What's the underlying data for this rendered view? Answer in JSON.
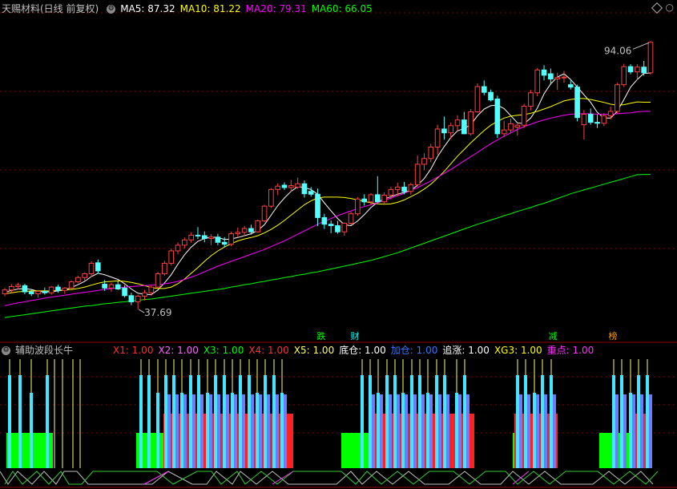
{
  "main_panel": {
    "title": "天赐材料(日线 前复权)",
    "indicators": [
      {
        "label": "MA5:",
        "value": "87.32",
        "color": "#ffffff"
      },
      {
        "label": "MA10:",
        "value": "81.22",
        "color": "#ffff00"
      },
      {
        "label": "MA20:",
        "value": "79.31",
        "color": "#ff00ff"
      },
      {
        "label": "MA60:",
        "value": "66.05",
        "color": "#00ff00"
      }
    ],
    "high_label": "94.06",
    "low_label": "37.69"
  },
  "signal_tags": [
    {
      "text": "跌",
      "color": "#00ff00"
    },
    {
      "text": "财",
      "color": "#00ffff"
    },
    {
      "text": "减",
      "color": "#00ff00"
    },
    {
      "text": "榜",
      "color": "#ff9900"
    }
  ],
  "sub_panel": {
    "title": "辅助波段长牛",
    "indicators": [
      {
        "label": "X1:",
        "value": "1.00",
        "color": "#ff3030"
      },
      {
        "label": "X2:",
        "value": "1.00",
        "color": "#ff66ff"
      },
      {
        "label": "X3:",
        "value": "1.00",
        "color": "#00ff00"
      },
      {
        "label": "X4:",
        "value": "1.00",
        "color": "#ff3030"
      },
      {
        "label": "X5:",
        "value": "1.00",
        "color": "#ffff66"
      },
      {
        "label": "底仓:",
        "value": "1.00",
        "color": "#ffffff"
      },
      {
        "label": "加仓:",
        "value": "1.00",
        "color": "#3377ff"
      },
      {
        "label": "追涨:",
        "value": "1.00",
        "color": "#ffffff"
      },
      {
        "label": "XG3:",
        "value": "1.00",
        "color": "#ffff00"
      },
      {
        "label": "重点:",
        "value": "1.00",
        "color": "#ff33ff"
      }
    ]
  },
  "chart_data": {
    "type": "candlestick",
    "title": "天赐材料(日线 前复权)",
    "ylim": [
      34,
      100
    ],
    "candles": [
      [
        41.0,
        42.2,
        40.5,
        41.8
      ],
      [
        41.8,
        43.0,
        41.2,
        42.5
      ],
      [
        42.5,
        43.3,
        41.9,
        42.8
      ],
      [
        42.7,
        43.1,
        40.9,
        41.4
      ],
      [
        41.4,
        42.0,
        40.5,
        41.0
      ],
      [
        41.0,
        41.8,
        40.2,
        41.5
      ],
      [
        41.5,
        42.3,
        40.8,
        41.2
      ],
      [
        41.2,
        42.6,
        40.8,
        42.4
      ],
      [
        42.4,
        42.9,
        41.2,
        41.7
      ],
      [
        41.7,
        42.4,
        41.0,
        42.2
      ],
      [
        42.2,
        43.8,
        42.0,
        43.5
      ],
      [
        43.5,
        44.8,
        43.2,
        44.4
      ],
      [
        44.4,
        45.5,
        43.8,
        45.2
      ],
      [
        45.2,
        47.8,
        44.5,
        47.4
      ],
      [
        47.5,
        48.2,
        45.2,
        45.8
      ],
      [
        43.0,
        43.9,
        41.6,
        42.2
      ],
      [
        42.2,
        43.3,
        41.4,
        42.9
      ],
      [
        42.9,
        43.6,
        41.8,
        42.0
      ],
      [
        42.2,
        42.8,
        40.2,
        40.6
      ],
      [
        40.6,
        41.2,
        38.6,
        39.3
      ],
      [
        39.3,
        40.8,
        37.7,
        40.5
      ],
      [
        40.5,
        41.8,
        39.6,
        41.2
      ],
      [
        41.2,
        42.8,
        40.6,
        42.4
      ],
      [
        42.4,
        45.6,
        42.1,
        45.2
      ],
      [
        45.2,
        47.9,
        44.8,
        47.4
      ],
      [
        47.4,
        50.5,
        46.9,
        50.0
      ],
      [
        50.0,
        51.8,
        49.3,
        51.2
      ],
      [
        51.2,
        52.8,
        50.5,
        52.3
      ],
      [
        52.3,
        53.9,
        51.7,
        53.3
      ],
      [
        53.3,
        55.0,
        52.5,
        53.2
      ],
      [
        53.2,
        54.1,
        51.8,
        52.6
      ],
      [
        52.6,
        53.5,
        51.2,
        52.9
      ],
      [
        52.9,
        53.6,
        51.2,
        51.8
      ],
      [
        51.8,
        52.9,
        50.8,
        51.4
      ],
      [
        51.4,
        54.0,
        51.0,
        53.6
      ],
      [
        53.6,
        54.9,
        52.8,
        53.9
      ],
      [
        53.9,
        55.2,
        53.1,
        54.7
      ],
      [
        54.7,
        55.5,
        53.4,
        54.0
      ],
      [
        54.0,
        56.6,
        53.8,
        56.3
      ],
      [
        56.3,
        59.7,
        56.0,
        59.4
      ],
      [
        59.4,
        63.2,
        59.0,
        62.9
      ],
      [
        62.9,
        64.2,
        61.7,
        63.6
      ],
      [
        63.8,
        64.4,
        62.8,
        63.3
      ],
      [
        63.3,
        64.9,
        62.4,
        63.7
      ],
      [
        63.4,
        65.4,
        63.0,
        64.1
      ],
      [
        64.1,
        64.8,
        61.2,
        62.0
      ],
      [
        62.5,
        63.4,
        61.4,
        61.9
      ],
      [
        61.9,
        63.1,
        55.2,
        57.0
      ],
      [
        57.0,
        57.8,
        54.6,
        55.6
      ],
      [
        55.6,
        56.4,
        53.7,
        55.3
      ],
      [
        55.3,
        56.3,
        53.6,
        54.0
      ],
      [
        54.0,
        56.0,
        53.2,
        55.8
      ],
      [
        55.8,
        58.2,
        55.4,
        57.8
      ],
      [
        57.8,
        61.3,
        57.4,
        60.9
      ],
      [
        60.9,
        61.9,
        59.5,
        60.3
      ],
      [
        60.3,
        62.1,
        59.6,
        61.8
      ],
      [
        61.8,
        65.7,
        61.3,
        60.3
      ],
      [
        60.3,
        62.3,
        59.7,
        61.7
      ],
      [
        61.7,
        63.5,
        60.8,
        62.9
      ],
      [
        62.9,
        64.3,
        61.5,
        63.4
      ],
      [
        63.4,
        64.5,
        61.9,
        62.5
      ],
      [
        62.5,
        64.3,
        61.8,
        63.9
      ],
      [
        63.9,
        70.0,
        63.5,
        68.2
      ],
      [
        68.2,
        70.5,
        67.0,
        69.4
      ],
      [
        69.4,
        72.5,
        68.6,
        71.8
      ],
      [
        71.8,
        76.5,
        70.2,
        75.6
      ],
      [
        75.6,
        78.2,
        73.4,
        74.8
      ],
      [
        74.8,
        76.9,
        73.6,
        76.3
      ],
      [
        76.3,
        78.5,
        75.2,
        77.5
      ],
      [
        77.5,
        79.2,
        74.5,
        74.6
      ],
      [
        74.6,
        79.8,
        74.2,
        79.2
      ],
      [
        79.2,
        85.2,
        79.0,
        84.5
      ],
      [
        84.5,
        85.8,
        82.7,
        83.3
      ],
      [
        83.3,
        83.9,
        81.4,
        81.7
      ],
      [
        81.9,
        82.6,
        73.7,
        74.6
      ],
      [
        74.6,
        77.3,
        74.0,
        75.4
      ],
      [
        75.4,
        77.8,
        74.7,
        76.7
      ],
      [
        76.0,
        76.9,
        74.2,
        76.4
      ],
      [
        76.4,
        80.9,
        75.8,
        80.4
      ],
      [
        80.4,
        83.8,
        79.5,
        83.2
      ],
      [
        83.2,
        88.4,
        82.5,
        88.0
      ],
      [
        88.0,
        89.0,
        85.8,
        86.9
      ],
      [
        87.2,
        88.3,
        84.9,
        86.1
      ],
      [
        86.1,
        87.4,
        83.8,
        86.4
      ],
      [
        86.4,
        87.8,
        85.3,
        86.5
      ],
      [
        84.9,
        85.8,
        83.9,
        84.4
      ],
      [
        84.4,
        84.9,
        77.2,
        78.0
      ],
      [
        76.5,
        79.6,
        73.4,
        78.7
      ],
      [
        78.7,
        79.9,
        76.5,
        77.0
      ],
      [
        77.0,
        78.6,
        75.8,
        76.8
      ],
      [
        76.8,
        78.9,
        76.2,
        78.4
      ],
      [
        78.4,
        80.3,
        77.6,
        79.3
      ],
      [
        79.3,
        85.3,
        78.9,
        84.9
      ],
      [
        84.9,
        89.3,
        84.4,
        88.7
      ],
      [
        88.7,
        89.2,
        87.1,
        87.6
      ],
      [
        87.6,
        89.2,
        85.9,
        88.6
      ],
      [
        88.6,
        89.9,
        86.8,
        87.4
      ],
      [
        87.4,
        94.06,
        87.0,
        93.8
      ]
    ],
    "lines": [
      {
        "name": "MA5",
        "color": "#ffffff",
        "values": [
          41.3,
          41.7,
          42.0,
          42.1,
          41.9,
          41.5,
          41.4,
          41.4,
          41.6,
          41.8,
          42.3,
          42.9,
          43.6,
          44.6,
          45.3,
          45.0,
          44.5,
          44.0,
          43.1,
          42.0,
          41.1,
          40.9,
          40.8,
          41.8,
          43.3,
          45.0,
          47.2,
          49.2,
          50.8,
          52.0,
          52.6,
          52.9,
          52.8,
          52.4,
          52.5,
          52.8,
          53.2,
          53.6,
          54.3,
          55.5,
          57.5,
          59.5,
          61.1,
          62.5,
          63.5,
          63.3,
          62.9,
          61.9,
          60.1,
          58.4,
          56.8,
          55.5,
          55.3,
          56.3,
          57.6,
          59.1,
          60.2,
          60.9,
          61.4,
          61.9,
          62.3,
          62.7,
          63.8,
          65.2,
          67.2,
          69.8,
          71.9,
          73.8,
          75.2,
          75.7,
          76.5,
          78.4,
          79.8,
          80.5,
          80.6,
          79.9,
          78.4,
          76.9,
          76.7,
          77.9,
          80.0,
          83.0,
          85.1,
          86.5,
          87.2,
          86.0,
          84.4,
          82.8,
          81.2,
          79.1,
          77.9,
          77.9,
          79.3,
          81.8,
          84.4,
          86.0,
          87.3,
          87.32
        ]
      },
      {
        "name": "MA10",
        "color": "#ffff00",
        "values": [
          41.0,
          41.2,
          41.4,
          41.5,
          41.6,
          41.6,
          41.6,
          41.6,
          41.7,
          41.8,
          41.9,
          42.1,
          42.4,
          42.8,
          43.2,
          43.5,
          43.6,
          43.7,
          43.6,
          43.4,
          43.1,
          42.7,
          42.3,
          42.1,
          42.1,
          42.4,
          43.1,
          44.1,
          45.3,
          46.5,
          47.8,
          49.0,
          50.0,
          50.8,
          51.5,
          52.1,
          52.5,
          52.8,
          53.2,
          53.8,
          54.5,
          55.4,
          56.4,
          57.5,
          58.6,
          59.7,
          60.5,
          61.1,
          61.3,
          61.3,
          61.3,
          61.2,
          61.0,
          60.7,
          60.4,
          60.1,
          59.9,
          59.8,
          59.9,
          60.2,
          60.7,
          61.4,
          62.1,
          63.0,
          64.0,
          65.3,
          66.7,
          68.3,
          69.9,
          71.3,
          72.7,
          74.0,
          75.3,
          76.4,
          77.2,
          77.9,
          78.3,
          78.5,
          78.6,
          78.9,
          79.3,
          79.8,
          80.3,
          80.9,
          81.5,
          81.8,
          82.0,
          82.0,
          81.8,
          81.5,
          81.2,
          80.8,
          80.6,
          80.7,
          81.0,
          81.3,
          81.22,
          81.22
        ]
      },
      {
        "name": "MA20",
        "color": "#ff00ff",
        "values": [
          38.5,
          38.8,
          39.1,
          39.3,
          39.6,
          39.8,
          40.1,
          40.3,
          40.5,
          40.7,
          40.9,
          41.1,
          41.3,
          41.5,
          41.7,
          41.9,
          42.1,
          42.2,
          42.4,
          42.5,
          42.6,
          42.7,
          42.8,
          42.9,
          43.1,
          43.3,
          43.6,
          44.0,
          44.5,
          45.0,
          45.6,
          46.2,
          46.8,
          47.3,
          47.8,
          48.3,
          48.8,
          49.3,
          49.8,
          50.3,
          50.9,
          51.5,
          52.1,
          52.8,
          53.5,
          54.2,
          54.9,
          55.6,
          56.2,
          56.8,
          57.4,
          57.9,
          58.4,
          58.9,
          59.3,
          59.7,
          60.1,
          60.6,
          61.1,
          61.6,
          62.1,
          62.7,
          63.3,
          64.0,
          64.7,
          65.5,
          66.3,
          67.1,
          68.0,
          68.9,
          69.8,
          70.7,
          71.6,
          72.5,
          73.3,
          74.1,
          74.8,
          75.5,
          76.1,
          76.6,
          77.1,
          77.5,
          77.9,
          78.2,
          78.5,
          78.7,
          78.8,
          78.8,
          78.8,
          78.7,
          78.7,
          78.7,
          78.8,
          78.9,
          79.0,
          79.2,
          79.31,
          79.31
        ]
      },
      {
        "name": "MA60",
        "color": "#00ff00",
        "values": [
          36.0,
          36.2,
          36.4,
          36.6,
          36.8,
          37.0,
          37.2,
          37.4,
          37.6,
          37.8,
          38.0,
          38.2,
          38.4,
          38.5,
          38.7,
          38.9,
          39.0,
          39.2,
          39.3,
          39.5,
          39.6,
          39.8,
          39.9,
          40.1,
          40.3,
          40.5,
          40.7,
          40.9,
          41.1,
          41.3,
          41.5,
          41.7,
          41.9,
          42.1,
          42.4,
          42.6,
          42.9,
          43.1,
          43.4,
          43.6,
          43.9,
          44.1,
          44.4,
          44.6,
          44.9,
          45.1,
          45.4,
          45.6,
          45.9,
          46.2,
          46.5,
          46.8,
          47.1,
          47.4,
          47.7,
          48.0,
          48.4,
          48.8,
          49.2,
          49.6,
          50.1,
          50.6,
          51.1,
          51.6,
          52.1,
          52.6,
          53.1,
          53.6,
          54.1,
          54.6,
          55.1,
          55.6,
          56.0,
          56.5,
          56.9,
          57.4,
          57.8,
          58.3,
          58.7,
          59.1,
          59.6,
          60.0,
          60.5,
          61.0,
          61.5,
          62.0,
          62.4,
          62.8,
          63.2,
          63.6,
          64.0,
          64.4,
          64.8,
          65.2,
          65.6,
          66.0,
          66.05,
          66.05
        ]
      }
    ]
  }
}
